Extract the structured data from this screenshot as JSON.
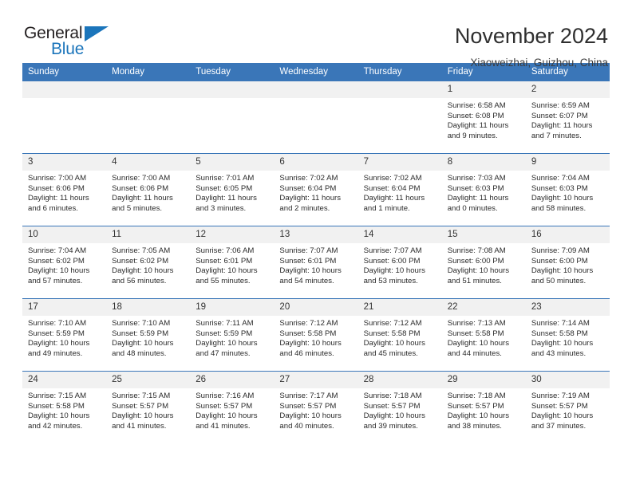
{
  "brand": {
    "name_part1": "General",
    "name_part2": "Blue",
    "triangle_color": "#1b75bb"
  },
  "header": {
    "title": "November 2024",
    "subtitle": "Xiaoweizhai, Guizhou, China"
  },
  "theme": {
    "header_blue": "#3a76b8",
    "daynum_gray": "#f1f1f1",
    "text": "#2b2b2b"
  },
  "weekday_headers": [
    "Sunday",
    "Monday",
    "Tuesday",
    "Wednesday",
    "Thursday",
    "Friday",
    "Saturday"
  ],
  "labels": {
    "sunrise": "Sunrise:",
    "sunset": "Sunset:",
    "daylight": "Daylight:"
  },
  "weeks": [
    [
      {
        "day": "",
        "empty": true,
        "sunrise": "",
        "sunset": "",
        "daylight_line1": "",
        "daylight_line2": ""
      },
      {
        "day": "",
        "empty": true,
        "sunrise": "",
        "sunset": "",
        "daylight_line1": "",
        "daylight_line2": ""
      },
      {
        "day": "",
        "empty": true,
        "sunrise": "",
        "sunset": "",
        "daylight_line1": "",
        "daylight_line2": ""
      },
      {
        "day": "",
        "empty": true,
        "sunrise": "",
        "sunset": "",
        "daylight_line1": "",
        "daylight_line2": ""
      },
      {
        "day": "",
        "empty": true,
        "sunrise": "",
        "sunset": "",
        "daylight_line1": "",
        "daylight_line2": ""
      },
      {
        "day": "1",
        "empty": false,
        "sunrise": "Sunrise: 6:58 AM",
        "sunset": "Sunset: 6:08 PM",
        "daylight_line1": "Daylight: 11 hours",
        "daylight_line2": "and 9 minutes."
      },
      {
        "day": "2",
        "empty": false,
        "sunrise": "Sunrise: 6:59 AM",
        "sunset": "Sunset: 6:07 PM",
        "daylight_line1": "Daylight: 11 hours",
        "daylight_line2": "and 7 minutes."
      }
    ],
    [
      {
        "day": "3",
        "empty": false,
        "sunrise": "Sunrise: 7:00 AM",
        "sunset": "Sunset: 6:06 PM",
        "daylight_line1": "Daylight: 11 hours",
        "daylight_line2": "and 6 minutes."
      },
      {
        "day": "4",
        "empty": false,
        "sunrise": "Sunrise: 7:00 AM",
        "sunset": "Sunset: 6:06 PM",
        "daylight_line1": "Daylight: 11 hours",
        "daylight_line2": "and 5 minutes."
      },
      {
        "day": "5",
        "empty": false,
        "sunrise": "Sunrise: 7:01 AM",
        "sunset": "Sunset: 6:05 PM",
        "daylight_line1": "Daylight: 11 hours",
        "daylight_line2": "and 3 minutes."
      },
      {
        "day": "6",
        "empty": false,
        "sunrise": "Sunrise: 7:02 AM",
        "sunset": "Sunset: 6:04 PM",
        "daylight_line1": "Daylight: 11 hours",
        "daylight_line2": "and 2 minutes."
      },
      {
        "day": "7",
        "empty": false,
        "sunrise": "Sunrise: 7:02 AM",
        "sunset": "Sunset: 6:04 PM",
        "daylight_line1": "Daylight: 11 hours",
        "daylight_line2": "and 1 minute."
      },
      {
        "day": "8",
        "empty": false,
        "sunrise": "Sunrise: 7:03 AM",
        "sunset": "Sunset: 6:03 PM",
        "daylight_line1": "Daylight: 11 hours",
        "daylight_line2": "and 0 minutes."
      },
      {
        "day": "9",
        "empty": false,
        "sunrise": "Sunrise: 7:04 AM",
        "sunset": "Sunset: 6:03 PM",
        "daylight_line1": "Daylight: 10 hours",
        "daylight_line2": "and 58 minutes."
      }
    ],
    [
      {
        "day": "10",
        "empty": false,
        "sunrise": "Sunrise: 7:04 AM",
        "sunset": "Sunset: 6:02 PM",
        "daylight_line1": "Daylight: 10 hours",
        "daylight_line2": "and 57 minutes."
      },
      {
        "day": "11",
        "empty": false,
        "sunrise": "Sunrise: 7:05 AM",
        "sunset": "Sunset: 6:02 PM",
        "daylight_line1": "Daylight: 10 hours",
        "daylight_line2": "and 56 minutes."
      },
      {
        "day": "12",
        "empty": false,
        "sunrise": "Sunrise: 7:06 AM",
        "sunset": "Sunset: 6:01 PM",
        "daylight_line1": "Daylight: 10 hours",
        "daylight_line2": "and 55 minutes."
      },
      {
        "day": "13",
        "empty": false,
        "sunrise": "Sunrise: 7:07 AM",
        "sunset": "Sunset: 6:01 PM",
        "daylight_line1": "Daylight: 10 hours",
        "daylight_line2": "and 54 minutes."
      },
      {
        "day": "14",
        "empty": false,
        "sunrise": "Sunrise: 7:07 AM",
        "sunset": "Sunset: 6:00 PM",
        "daylight_line1": "Daylight: 10 hours",
        "daylight_line2": "and 53 minutes."
      },
      {
        "day": "15",
        "empty": false,
        "sunrise": "Sunrise: 7:08 AM",
        "sunset": "Sunset: 6:00 PM",
        "daylight_line1": "Daylight: 10 hours",
        "daylight_line2": "and 51 minutes."
      },
      {
        "day": "16",
        "empty": false,
        "sunrise": "Sunrise: 7:09 AM",
        "sunset": "Sunset: 6:00 PM",
        "daylight_line1": "Daylight: 10 hours",
        "daylight_line2": "and 50 minutes."
      }
    ],
    [
      {
        "day": "17",
        "empty": false,
        "sunrise": "Sunrise: 7:10 AM",
        "sunset": "Sunset: 5:59 PM",
        "daylight_line1": "Daylight: 10 hours",
        "daylight_line2": "and 49 minutes."
      },
      {
        "day": "18",
        "empty": false,
        "sunrise": "Sunrise: 7:10 AM",
        "sunset": "Sunset: 5:59 PM",
        "daylight_line1": "Daylight: 10 hours",
        "daylight_line2": "and 48 minutes."
      },
      {
        "day": "19",
        "empty": false,
        "sunrise": "Sunrise: 7:11 AM",
        "sunset": "Sunset: 5:59 PM",
        "daylight_line1": "Daylight: 10 hours",
        "daylight_line2": "and 47 minutes."
      },
      {
        "day": "20",
        "empty": false,
        "sunrise": "Sunrise: 7:12 AM",
        "sunset": "Sunset: 5:58 PM",
        "daylight_line1": "Daylight: 10 hours",
        "daylight_line2": "and 46 minutes."
      },
      {
        "day": "21",
        "empty": false,
        "sunrise": "Sunrise: 7:12 AM",
        "sunset": "Sunset: 5:58 PM",
        "daylight_line1": "Daylight: 10 hours",
        "daylight_line2": "and 45 minutes."
      },
      {
        "day": "22",
        "empty": false,
        "sunrise": "Sunrise: 7:13 AM",
        "sunset": "Sunset: 5:58 PM",
        "daylight_line1": "Daylight: 10 hours",
        "daylight_line2": "and 44 minutes."
      },
      {
        "day": "23",
        "empty": false,
        "sunrise": "Sunrise: 7:14 AM",
        "sunset": "Sunset: 5:58 PM",
        "daylight_line1": "Daylight: 10 hours",
        "daylight_line2": "and 43 minutes."
      }
    ],
    [
      {
        "day": "24",
        "empty": false,
        "sunrise": "Sunrise: 7:15 AM",
        "sunset": "Sunset: 5:58 PM",
        "daylight_line1": "Daylight: 10 hours",
        "daylight_line2": "and 42 minutes."
      },
      {
        "day": "25",
        "empty": false,
        "sunrise": "Sunrise: 7:15 AM",
        "sunset": "Sunset: 5:57 PM",
        "daylight_line1": "Daylight: 10 hours",
        "daylight_line2": "and 41 minutes."
      },
      {
        "day": "26",
        "empty": false,
        "sunrise": "Sunrise: 7:16 AM",
        "sunset": "Sunset: 5:57 PM",
        "daylight_line1": "Daylight: 10 hours",
        "daylight_line2": "and 41 minutes."
      },
      {
        "day": "27",
        "empty": false,
        "sunrise": "Sunrise: 7:17 AM",
        "sunset": "Sunset: 5:57 PM",
        "daylight_line1": "Daylight: 10 hours",
        "daylight_line2": "and 40 minutes."
      },
      {
        "day": "28",
        "empty": false,
        "sunrise": "Sunrise: 7:18 AM",
        "sunset": "Sunset: 5:57 PM",
        "daylight_line1": "Daylight: 10 hours",
        "daylight_line2": "and 39 minutes."
      },
      {
        "day": "29",
        "empty": false,
        "sunrise": "Sunrise: 7:18 AM",
        "sunset": "Sunset: 5:57 PM",
        "daylight_line1": "Daylight: 10 hours",
        "daylight_line2": "and 38 minutes."
      },
      {
        "day": "30",
        "empty": false,
        "sunrise": "Sunrise: 7:19 AM",
        "sunset": "Sunset: 5:57 PM",
        "daylight_line1": "Daylight: 10 hours",
        "daylight_line2": "and 37 minutes."
      }
    ]
  ]
}
